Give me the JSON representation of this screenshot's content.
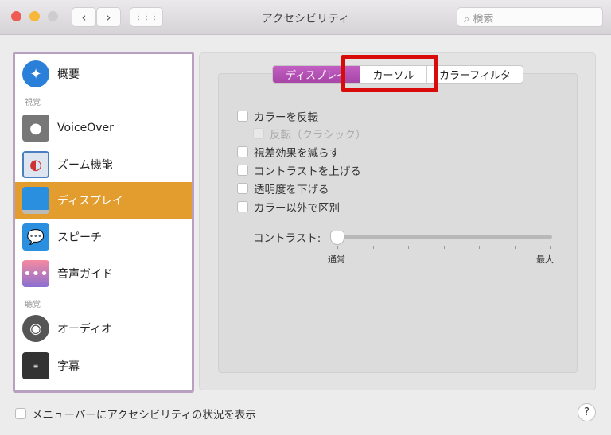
{
  "window": {
    "title": "アクセシビリティ",
    "search_placeholder": "検索",
    "back": "‹",
    "forward": "›",
    "grid": "⋮⋮⋮"
  },
  "sidebar": {
    "sections": [
      "視覚",
      "聴覚"
    ],
    "items": [
      {
        "label": "概要",
        "icon": "accessibility-icon"
      },
      {
        "label": "VoiceOver",
        "icon": "voiceover-icon"
      },
      {
        "label": "ズーム機能",
        "icon": "zoom-icon"
      },
      {
        "label": "ディスプレイ",
        "icon": "display-icon",
        "selected": true
      },
      {
        "label": "スピーチ",
        "icon": "speech-icon"
      },
      {
        "label": "音声ガイド",
        "icon": "descriptions-icon"
      },
      {
        "label": "オーディオ",
        "icon": "speaker-icon"
      },
      {
        "label": "字幕",
        "icon": "captions-icon"
      }
    ]
  },
  "tabs": [
    {
      "label": "ディスプレイ",
      "selected": true
    },
    {
      "label": "カーソル"
    },
    {
      "label": "カラーフィルタ"
    }
  ],
  "options": [
    {
      "label": "カラーを反転",
      "checked": false
    },
    {
      "label": "反転（クラシック）",
      "checked": false,
      "disabled": true
    },
    {
      "label": "視差効果を減らす",
      "checked": false
    },
    {
      "label": "コントラストを上げる",
      "checked": false
    },
    {
      "label": "透明度を下げる",
      "checked": false
    },
    {
      "label": "カラー以外で区別",
      "checked": false
    }
  ],
  "contrast": {
    "label": "コントラスト:",
    "min_label": "通常",
    "max_label": "最大",
    "value": 0
  },
  "footer": {
    "menubar_label": "メニューバーにアクセシビリティの状況を表示",
    "menubar_checked": false,
    "help": "?"
  },
  "colors": {
    "selection": "#e39d2f",
    "active_tab": "#b04fb0",
    "highlight": "#d80a0a"
  }
}
